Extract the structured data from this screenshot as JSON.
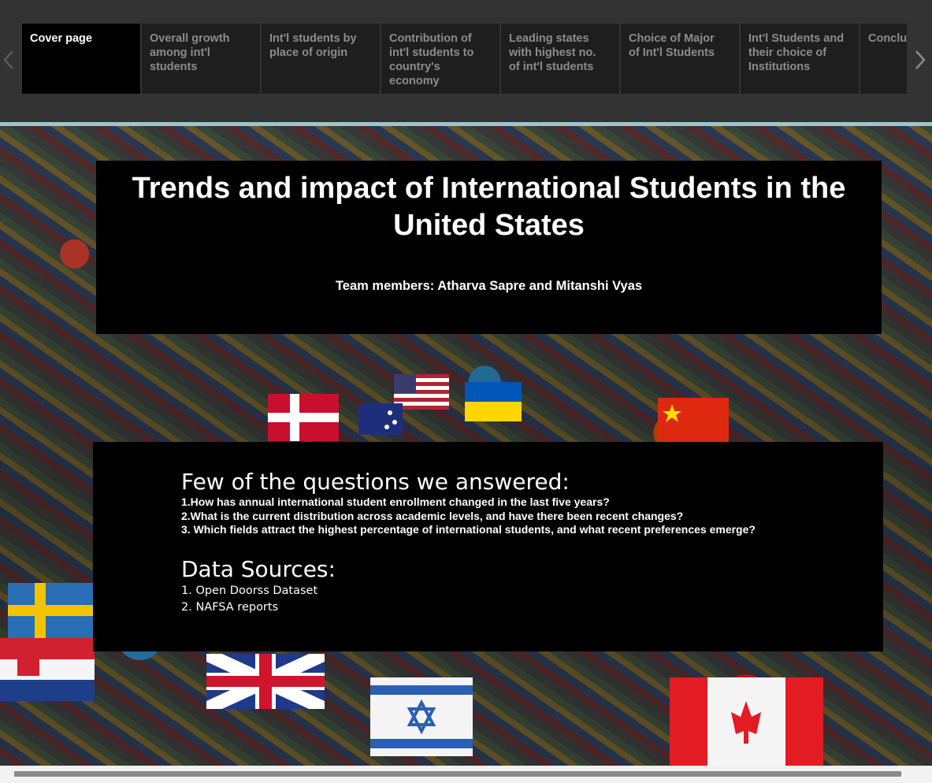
{
  "navigator": {
    "tabs": [
      {
        "label": "Cover page",
        "active": true
      },
      {
        "label": "Overall growth\namong int'l\nstudents",
        "active": false
      },
      {
        "label": "Int'l students by\nplace of origin",
        "active": false
      },
      {
        "label": "Contribution of\nint'l students to\ncountry's\neconomy",
        "active": false
      },
      {
        "label": "Leading states\nwith highest no.\nof int'l students",
        "active": false
      },
      {
        "label": "Choice of Major\nof Int'l Students",
        "active": false
      },
      {
        "label": "Int'l Students and\ntheir choice of\nInstitutions",
        "active": false
      },
      {
        "label": "Conclusion",
        "active": false
      }
    ],
    "prev_icon": "chevron-left-icon",
    "next_icon": "chevron-right-icon"
  },
  "cover": {
    "title": "Trends and impact of International Students in the United States",
    "team": "Team members: Atharva Sapre and Mitanshi Vyas"
  },
  "info": {
    "questions_heading": "Few of the questions we answered:",
    "questions": [
      "1.How has annual international student enrollment changed in the last five years?",
      "2.What is the current distribution across academic levels, and have there been recent changes?",
      "3. Which fields attract the highest percentage of international students, and what recent preferences emerge?"
    ],
    "sources_heading": "Data Sources:",
    "sources": [
      "1. Open Doorss Dataset",
      "2. NAFSA reports"
    ]
  },
  "colors": {
    "nav_bg": "#333333",
    "tab_bg": "#1e1e1e",
    "tab_active_bg": "#000000",
    "divider": "#9ec6cc",
    "panel_bg": "#000000"
  },
  "background_image": "crowd-of-graduates-waving-international-flags"
}
